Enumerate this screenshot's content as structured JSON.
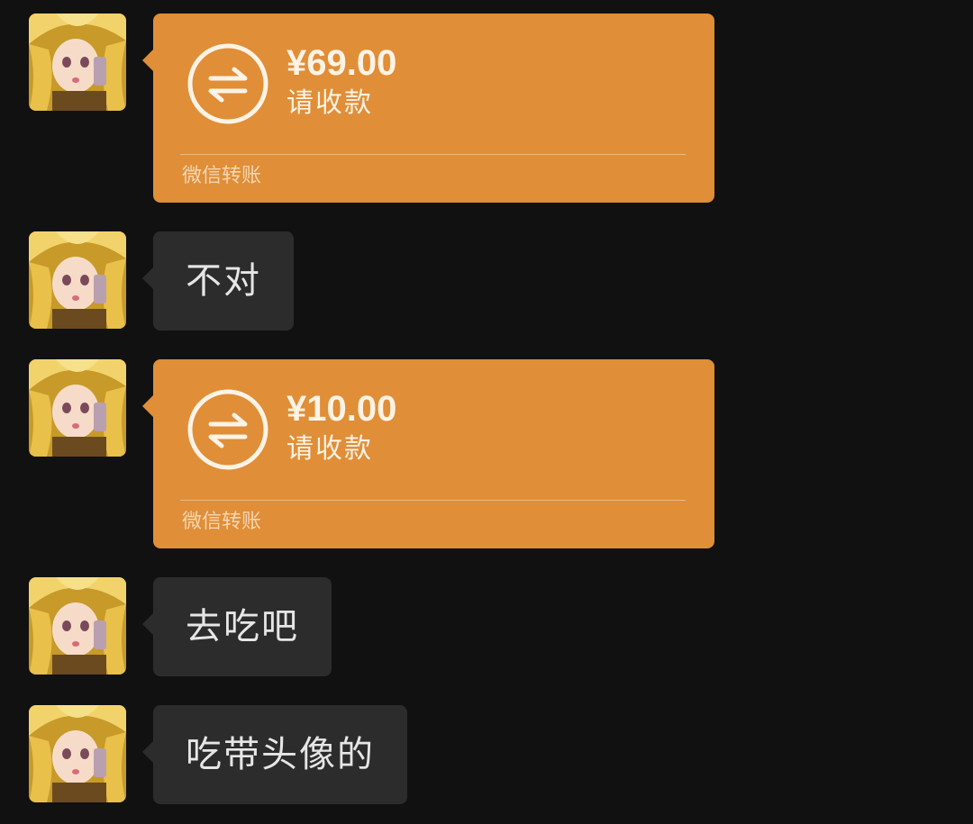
{
  "theme": {
    "background": "#111111",
    "text_bubble": "#2c2c2c",
    "transfer_bubble": "#e08e37",
    "transfer_text": "#fdf3e6"
  },
  "messages": [
    {
      "type": "transfer",
      "avatar": "avatar-image",
      "icon": "transfer-arrows-icon",
      "amount": "¥69.00",
      "status": "请收款",
      "footer": "微信转账"
    },
    {
      "type": "text",
      "avatar": "avatar-image",
      "text": "不对"
    },
    {
      "type": "transfer",
      "avatar": "avatar-image",
      "icon": "transfer-arrows-icon",
      "amount": "¥10.00",
      "status": "请收款",
      "footer": "微信转账"
    },
    {
      "type": "text",
      "avatar": "avatar-image",
      "text": "去吃吧"
    },
    {
      "type": "text",
      "avatar": "avatar-image",
      "text": "吃带头像的"
    }
  ]
}
